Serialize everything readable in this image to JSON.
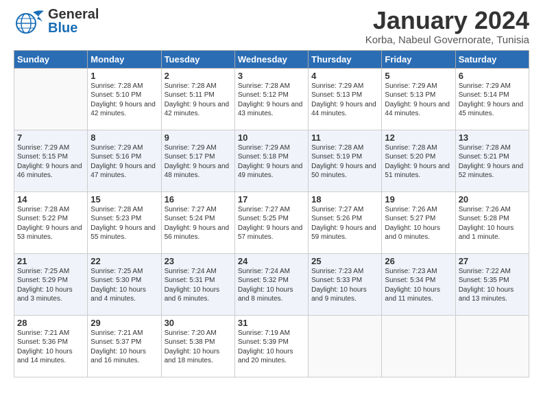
{
  "logo": {
    "general": "General",
    "blue": "Blue",
    "bird": "▶"
  },
  "title": "January 2024",
  "subtitle": "Korba, Nabeul Governorate, Tunisia",
  "weekdays": [
    "Sunday",
    "Monday",
    "Tuesday",
    "Wednesday",
    "Thursday",
    "Friday",
    "Saturday"
  ],
  "weeks": [
    [
      {
        "num": "",
        "sunrise": "",
        "sunset": "",
        "daylight": ""
      },
      {
        "num": "1",
        "sunrise": "7:28 AM",
        "sunset": "5:10 PM",
        "daylight": "9 hours and 42 minutes."
      },
      {
        "num": "2",
        "sunrise": "7:28 AM",
        "sunset": "5:11 PM",
        "daylight": "9 hours and 42 minutes."
      },
      {
        "num": "3",
        "sunrise": "7:28 AM",
        "sunset": "5:12 PM",
        "daylight": "9 hours and 43 minutes."
      },
      {
        "num": "4",
        "sunrise": "7:29 AM",
        "sunset": "5:13 PM",
        "daylight": "9 hours and 44 minutes."
      },
      {
        "num": "5",
        "sunrise": "7:29 AM",
        "sunset": "5:13 PM",
        "daylight": "9 hours and 44 minutes."
      },
      {
        "num": "6",
        "sunrise": "7:29 AM",
        "sunset": "5:14 PM",
        "daylight": "9 hours and 45 minutes."
      }
    ],
    [
      {
        "num": "7",
        "sunrise": "7:29 AM",
        "sunset": "5:15 PM",
        "daylight": "9 hours and 46 minutes."
      },
      {
        "num": "8",
        "sunrise": "7:29 AM",
        "sunset": "5:16 PM",
        "daylight": "9 hours and 47 minutes."
      },
      {
        "num": "9",
        "sunrise": "7:29 AM",
        "sunset": "5:17 PM",
        "daylight": "9 hours and 48 minutes."
      },
      {
        "num": "10",
        "sunrise": "7:29 AM",
        "sunset": "5:18 PM",
        "daylight": "9 hours and 49 minutes."
      },
      {
        "num": "11",
        "sunrise": "7:28 AM",
        "sunset": "5:19 PM",
        "daylight": "9 hours and 50 minutes."
      },
      {
        "num": "12",
        "sunrise": "7:28 AM",
        "sunset": "5:20 PM",
        "daylight": "9 hours and 51 minutes."
      },
      {
        "num": "13",
        "sunrise": "7:28 AM",
        "sunset": "5:21 PM",
        "daylight": "9 hours and 52 minutes."
      }
    ],
    [
      {
        "num": "14",
        "sunrise": "7:28 AM",
        "sunset": "5:22 PM",
        "daylight": "9 hours and 53 minutes."
      },
      {
        "num": "15",
        "sunrise": "7:28 AM",
        "sunset": "5:23 PM",
        "daylight": "9 hours and 55 minutes."
      },
      {
        "num": "16",
        "sunrise": "7:27 AM",
        "sunset": "5:24 PM",
        "daylight": "9 hours and 56 minutes."
      },
      {
        "num": "17",
        "sunrise": "7:27 AM",
        "sunset": "5:25 PM",
        "daylight": "9 hours and 57 minutes."
      },
      {
        "num": "18",
        "sunrise": "7:27 AM",
        "sunset": "5:26 PM",
        "daylight": "9 hours and 59 minutes."
      },
      {
        "num": "19",
        "sunrise": "7:26 AM",
        "sunset": "5:27 PM",
        "daylight": "10 hours and 0 minutes."
      },
      {
        "num": "20",
        "sunrise": "7:26 AM",
        "sunset": "5:28 PM",
        "daylight": "10 hours and 1 minute."
      }
    ],
    [
      {
        "num": "21",
        "sunrise": "7:25 AM",
        "sunset": "5:29 PM",
        "daylight": "10 hours and 3 minutes."
      },
      {
        "num": "22",
        "sunrise": "7:25 AM",
        "sunset": "5:30 PM",
        "daylight": "10 hours and 4 minutes."
      },
      {
        "num": "23",
        "sunrise": "7:24 AM",
        "sunset": "5:31 PM",
        "daylight": "10 hours and 6 minutes."
      },
      {
        "num": "24",
        "sunrise": "7:24 AM",
        "sunset": "5:32 PM",
        "daylight": "10 hours and 8 minutes."
      },
      {
        "num": "25",
        "sunrise": "7:23 AM",
        "sunset": "5:33 PM",
        "daylight": "10 hours and 9 minutes."
      },
      {
        "num": "26",
        "sunrise": "7:23 AM",
        "sunset": "5:34 PM",
        "daylight": "10 hours and 11 minutes."
      },
      {
        "num": "27",
        "sunrise": "7:22 AM",
        "sunset": "5:35 PM",
        "daylight": "10 hours and 13 minutes."
      }
    ],
    [
      {
        "num": "28",
        "sunrise": "7:21 AM",
        "sunset": "5:36 PM",
        "daylight": "10 hours and 14 minutes."
      },
      {
        "num": "29",
        "sunrise": "7:21 AM",
        "sunset": "5:37 PM",
        "daylight": "10 hours and 16 minutes."
      },
      {
        "num": "30",
        "sunrise": "7:20 AM",
        "sunset": "5:38 PM",
        "daylight": "10 hours and 18 minutes."
      },
      {
        "num": "31",
        "sunrise": "7:19 AM",
        "sunset": "5:39 PM",
        "daylight": "10 hours and 20 minutes."
      },
      {
        "num": "",
        "sunrise": "",
        "sunset": "",
        "daylight": ""
      },
      {
        "num": "",
        "sunrise": "",
        "sunset": "",
        "daylight": ""
      },
      {
        "num": "",
        "sunrise": "",
        "sunset": "",
        "daylight": ""
      }
    ]
  ]
}
